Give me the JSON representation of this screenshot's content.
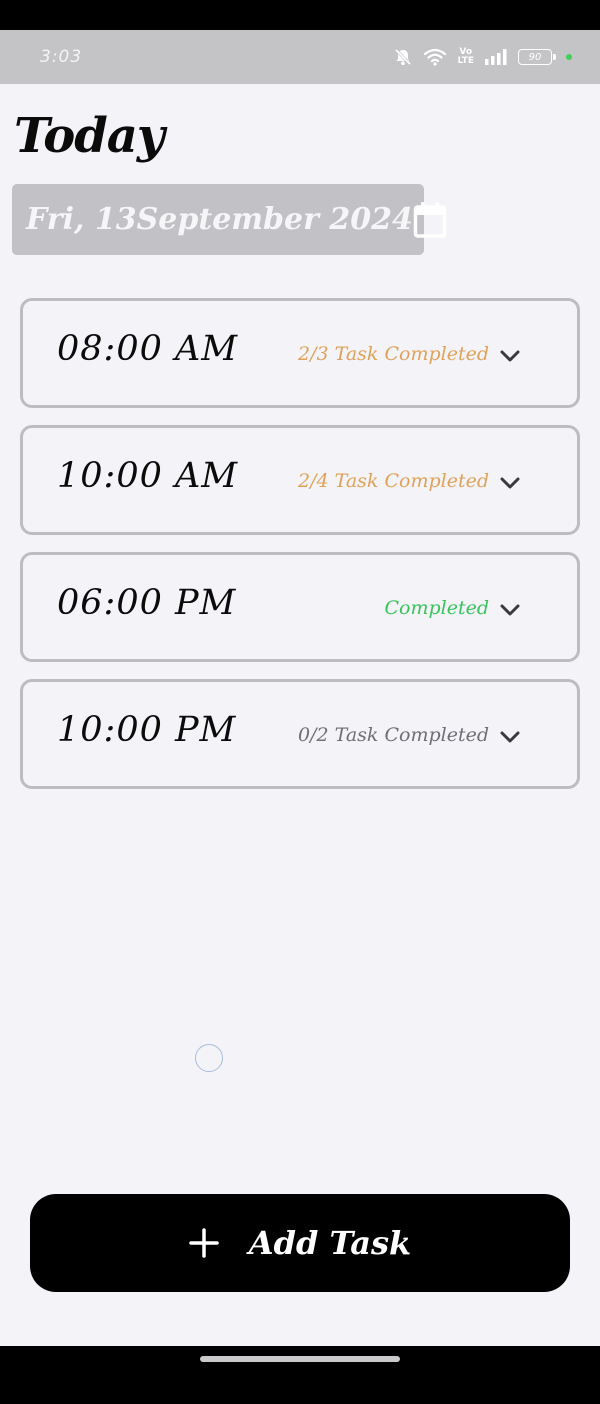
{
  "status_bar": {
    "time": "3:03",
    "battery": "90",
    "icons": [
      "mute-bell-icon",
      "wifi-icon",
      "volte-icon",
      "signal-icon",
      "battery-icon"
    ],
    "volte_top": "Vo",
    "volte_bottom": "LTE"
  },
  "header": {
    "title": "Today",
    "date": "Fri, 13September 2024",
    "date_icon": "calendar-icon"
  },
  "slots": [
    {
      "time": "08:00 AM",
      "status": "2/3 Task Completed",
      "status_color": "#e0a25a"
    },
    {
      "time": "10:00 AM",
      "status": "2/4 Task Completed",
      "status_color": "#e0a25a"
    },
    {
      "time": "06:00 PM",
      "status": "Completed",
      "status_color": "#37c45c"
    },
    {
      "time": "10:00 PM",
      "status": "0/2 Task Completed",
      "status_color": "#6f6f75"
    }
  ],
  "add_task": {
    "label": "Add Task",
    "icon": "plus-icon"
  },
  "colors": {
    "background": "#f4f3f7",
    "card_border": "#bdbcc0",
    "accent_pending": "#e0a25a",
    "accent_done": "#37c45c",
    "button": "#000000"
  }
}
